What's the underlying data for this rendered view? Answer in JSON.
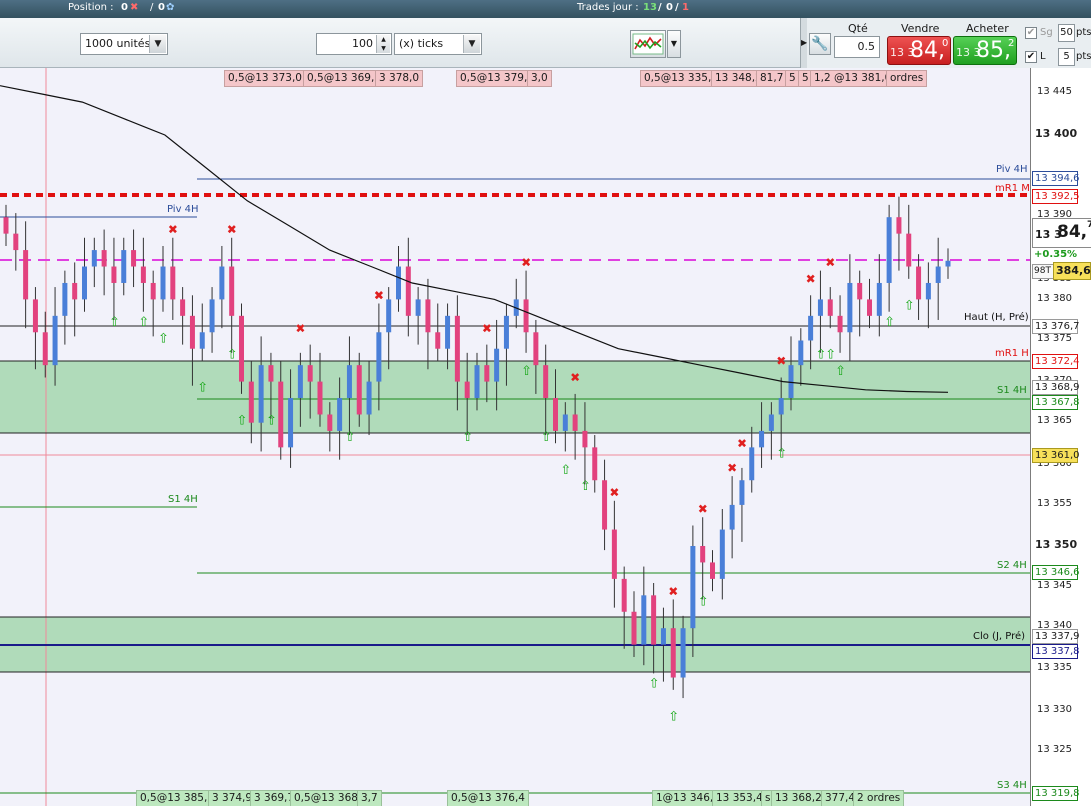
{
  "status": {
    "position_label": "Position :",
    "position_value": "0",
    "position_qty": "0",
    "trades_label": "Trades jour :",
    "trades_a": "13",
    "trades_b": "0",
    "trades_c": "1"
  },
  "toolbar": {
    "units": "1000 unités",
    "tick_value": "100",
    "tick_unit": "(x) ticks"
  },
  "order_panel": {
    "qty_label": "Qté",
    "qty_value": "0.5",
    "sell_label": "Vendre",
    "buy_label": "Acheter",
    "sell_prefix": "13 3",
    "sell_big": "84,",
    "sell_sup": "0",
    "buy_prefix": "13 3",
    "buy_big": "85,",
    "buy_sup": "2",
    "sg_label": "Sg",
    "sg_pts": "50",
    "l_label": "L",
    "l_pts": "5",
    "pts": "pts"
  },
  "axis": {
    "ticks": [
      "13 445",
      "13 400",
      "13 390",
      "13 385",
      "13 380",
      "13 375",
      "13 370",
      "13 365",
      "13 360",
      "13 355",
      "13 350",
      "13 345",
      "13 340",
      "13 335",
      "13 330",
      "13 325"
    ],
    "last_price": {
      "prefix": "13 3",
      "big": "84,",
      "sup": "7"
    },
    "change": "+0.35%",
    "volume_tag": "98T",
    "mid_price": "384,6",
    "price_tags": [
      "13 394,6",
      "13 392,5",
      "13 376,7",
      "13 372,4",
      "13 368,9",
      "13 367,8",
      "13 361,0",
      "13 346,6",
      "13 337,9",
      "13 337,8",
      "13 319,8"
    ]
  },
  "levels": {
    "piv4h": "Piv 4H",
    "piv4h_left": "Piv 4H",
    "mr1m": "mR1 M",
    "haut": "Haut (H, Pré)",
    "mr1h": "mR1 H",
    "s14h": "S1 4H",
    "s14h_left": "S1 4H",
    "s24h": "S2 4H",
    "clo": "Clo (J, Pré)",
    "s34h": "S3 4H"
  },
  "orders_top": [
    "0,5@13 373,0",
    "0,5@13 369,7",
    "3 378,0",
    "0,5@13 379,7",
    "3,0",
    "0,5@13 335,3",
    "13 348,2",
    "81,7",
    "5",
    "5",
    "1,2 @13 381,0",
    "ordres"
  ],
  "orders_bottom": [
    "0,5@13 385,3",
    "3 374,9",
    "3 369,7",
    "0,5@13 368,7",
    "3,7",
    "0,5@13 376,4",
    "1@13 346,7",
    "13 353,4",
    "s",
    "13 368,2",
    "377,4",
    "2 ordres"
  ],
  "chart_data": {
    "type": "candlestick",
    "y_range": [
      13320,
      13450
    ],
    "open": [
      13390,
      13388,
      13386,
      13380,
      13376,
      13372,
      13378,
      13382,
      13380,
      13384,
      13386,
      13384,
      13382,
      13386,
      13384,
      13382,
      13380,
      13384,
      13380,
      13378,
      13374,
      13376,
      13380,
      13384,
      13378,
      13370,
      13365,
      13372,
      13370,
      13362,
      13368,
      13372,
      13370,
      13366,
      13364,
      13368,
      13372,
      13366,
      13370,
      13376,
      13380,
      13384,
      13378,
      13380,
      13376,
      13374,
      13378,
      13370,
      13368,
      13372,
      13370,
      13374,
      13378,
      13380,
      13376,
      13372,
      13368,
      13364,
      13366,
      13364,
      13362,
      13358,
      13352,
      13346,
      13342,
      13338,
      13344,
      13338,
      13340,
      13334,
      13340,
      13350,
      13348,
      13346,
      13352,
      13355,
      13358,
      13362,
      13364,
      13366,
      13368,
      13372,
      13375,
      13378,
      13380,
      13378,
      13376,
      13382,
      13380,
      13378,
      13382,
      13390,
      13388,
      13384,
      13380,
      13382,
      13384
    ],
    "close": [
      13388,
      13386,
      13380,
      13376,
      13372,
      13378,
      13382,
      13380,
      13384,
      13386,
      13384,
      13382,
      13386,
      13384,
      13382,
      13380,
      13384,
      13380,
      13378,
      13374,
      13376,
      13380,
      13384,
      13378,
      13370,
      13365,
      13372,
      13370,
      13362,
      13368,
      13372,
      13370,
      13366,
      13364,
      13368,
      13372,
      13366,
      13370,
      13376,
      13380,
      13384,
      13378,
      13380,
      13376,
      13374,
      13378,
      13370,
      13368,
      13372,
      13370,
      13374,
      13378,
      13380,
      13376,
      13372,
      13368,
      13364,
      13366,
      13364,
      13362,
      13358,
      13352,
      13346,
      13342,
      13338,
      13344,
      13338,
      13340,
      13334,
      13340,
      13350,
      13348,
      13346,
      13352,
      13355,
      13358,
      13362,
      13364,
      13366,
      13368,
      13372,
      13375,
      13378,
      13380,
      13378,
      13376,
      13382,
      13380,
      13378,
      13382,
      13390,
      13388,
      13384,
      13380,
      13382,
      13384,
      13384.7
    ],
    "sma": [
      13406,
      13405,
      13404,
      13402,
      13400,
      13396,
      13392,
      13389,
      13386,
      13384,
      13382,
      13381,
      13380,
      13378,
      13376,
      13374,
      13373,
      13372,
      13371,
      13370,
      13369.5,
      13369,
      13368.8,
      13368.7
    ],
    "signals_buy": 22,
    "signals_sell": 16
  }
}
